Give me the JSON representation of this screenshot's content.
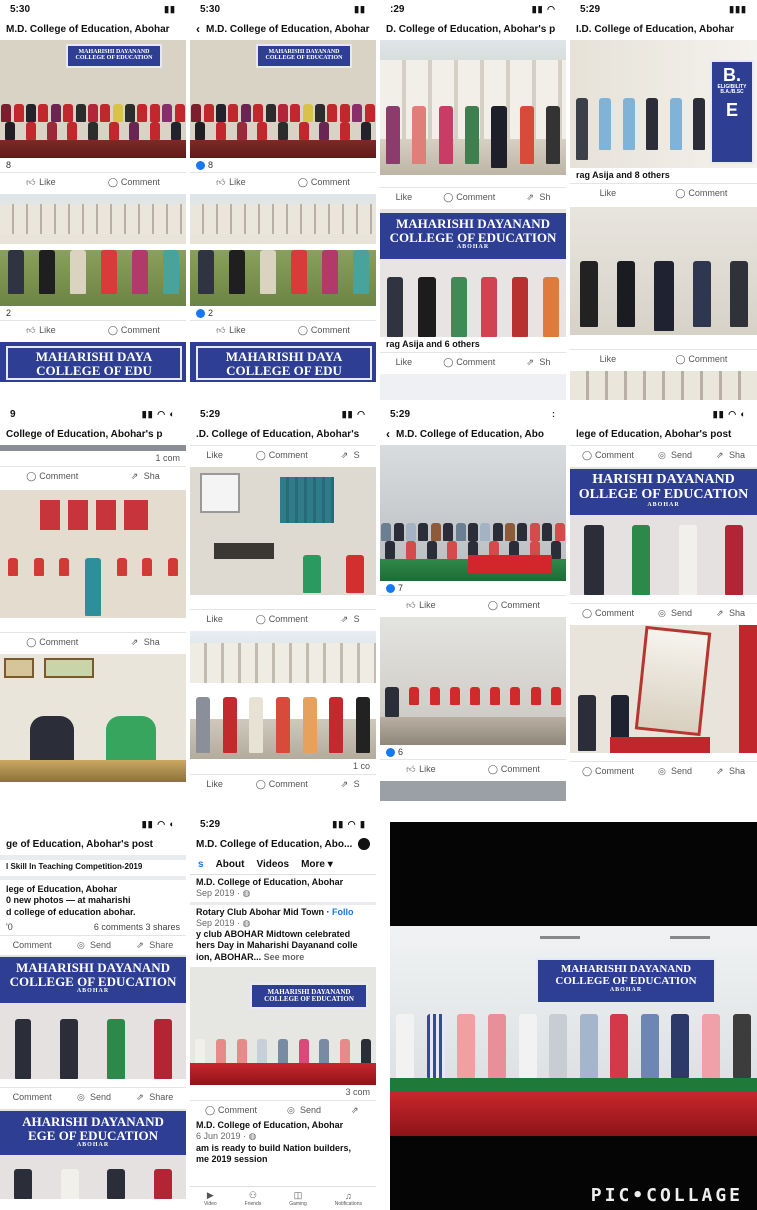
{
  "collage": {
    "watermark": "PIC•COLLAGE"
  },
  "tiles": {
    "t1": {
      "time": "5:30",
      "title": "M.D. College of Education, Abohar",
      "banner_line1": "MAHARISHI DAYANAND",
      "banner_line2": "COLLEGE OF EDUCATION",
      "reaction_count_1": "8",
      "reaction_count_2": "2",
      "like": "Like",
      "comment": "Comment",
      "banner2": "MAHARISHI DAYA COLLEGE OF EDU"
    },
    "t2": {
      "time": "5:30",
      "title": "M.D. College of Education, Abohar",
      "banner_line1": "MAHARISHI DAYANAND",
      "banner_line2": "COLLEGE OF EDUCATION",
      "reaction_count_1": "8",
      "reaction_count_2": "2",
      "like": "Like",
      "comment": "Comment",
      "banner2": "MAHARISHI DAYA COLLEGE OF EDU"
    },
    "t3": {
      "time": ":29",
      "title": "D. College of Education, Abohar's p",
      "like": "Like",
      "comment": "Comment",
      "share": "Sh",
      "banner_line1": "MAHARISHI DAYANAND",
      "banner_line2": "COLLEGE OF EDUCATION",
      "banner_sub": "ABOHAR",
      "tagged": "rag Asija and 6 others"
    },
    "t4": {
      "time": "5:29",
      "title": "I.D. College of Education, Abohar",
      "tagged": "rag Asija and 8 others",
      "like": "Like",
      "comment": "Comment",
      "sign_big1": "B.",
      "sign_small": "ELIGIBILITY B.A./B.SC",
      "sign_big2": "E"
    },
    "t5": {
      "time": "9",
      "title": "College of Education, Abohar's p",
      "comments": "1 com",
      "comment": "Comment",
      "share": "Sha"
    },
    "t6": {
      "time": "5:29",
      "title": ".D. College of Education, Abohar's",
      "like": "Like",
      "comment": "Comment",
      "share": "S",
      "comments": "1 co"
    },
    "t7": {
      "time": "5:29",
      "title": "M.D. College of Education, Abo",
      "reaction_count_1": "7",
      "reaction_count_2": "6",
      "like": "Like",
      "comment": "Comment"
    },
    "t8": {
      "title": "lege of Education, Abohar's post",
      "comment": "Comment",
      "send": "Send",
      "share": "Sha",
      "banner_line1": "HARISHI DAYANAND",
      "banner_line2": "OLLEGE OF EDUCATION",
      "banner_sub": "ABOHAR"
    },
    "t9": {
      "title": "ge of Education, Abohar's post",
      "headline": "l Skill In Teaching Competition-2019",
      "page_name": "lege of Education, Abohar",
      "post_line1": "0 new photos — at maharishi",
      "post_line2": "d college of education abohar.",
      "count": "'0",
      "comments": "6 comments",
      "shares": "3 shares",
      "comment": "Comment",
      "send": "Send",
      "share": "Share",
      "banner_line1": "MAHARISHI DAYANAND",
      "banner_line2": "COLLEGE OF EDUCATION",
      "banner_sub": "ABOHAR",
      "banner2_line1": "AHARISHI DAYANAND",
      "banner2_line2": "EGE OF EDUCATION",
      "banner2_sub": "ABOHAR"
    },
    "t10": {
      "time": "5:29",
      "title": "M.D. College of Education, Abo...",
      "tab_posts": "s",
      "tab_about": "About",
      "tab_videos": "Videos",
      "tab_more": "More ▾",
      "page_name": "M.D. College of Education, Abohar",
      "date1": "Sep 2019 · ",
      "shared_from": "Rotary Club Abohar Mid Town · ",
      "follow": "Follo",
      "date2": "Sep 2019 · ",
      "post_line1": "y club ABOHAR Midtown celebrated",
      "post_line2": "hers Day in Maharishi Dayanand colle",
      "post_line3": "ion, ABOHAR... ",
      "see_more": "See more",
      "banner_line1": "MAHARISHI DAYANAND",
      "banner_line2": "COLLEGE OF EDUCATION",
      "comments": "3 com",
      "comment": "Comment",
      "send": "Send",
      "page_name2": "M.D. College of Education, Abohar",
      "date3": "6 Jun 2019 · ",
      "post2_line1": "am is ready to build Nation builders,",
      "post2_line2": "me 2019 session",
      "nav_video": "Video",
      "nav_friends": "Friends",
      "nav_gaming": "Gaming",
      "nav_notifications": "Notifications"
    },
    "t11": {
      "banner_line1": "MAHARISHI DAYANAND",
      "banner_line2": "COLLEGE OF EDUCATION",
      "banner_sub": "ABOHAR"
    }
  }
}
